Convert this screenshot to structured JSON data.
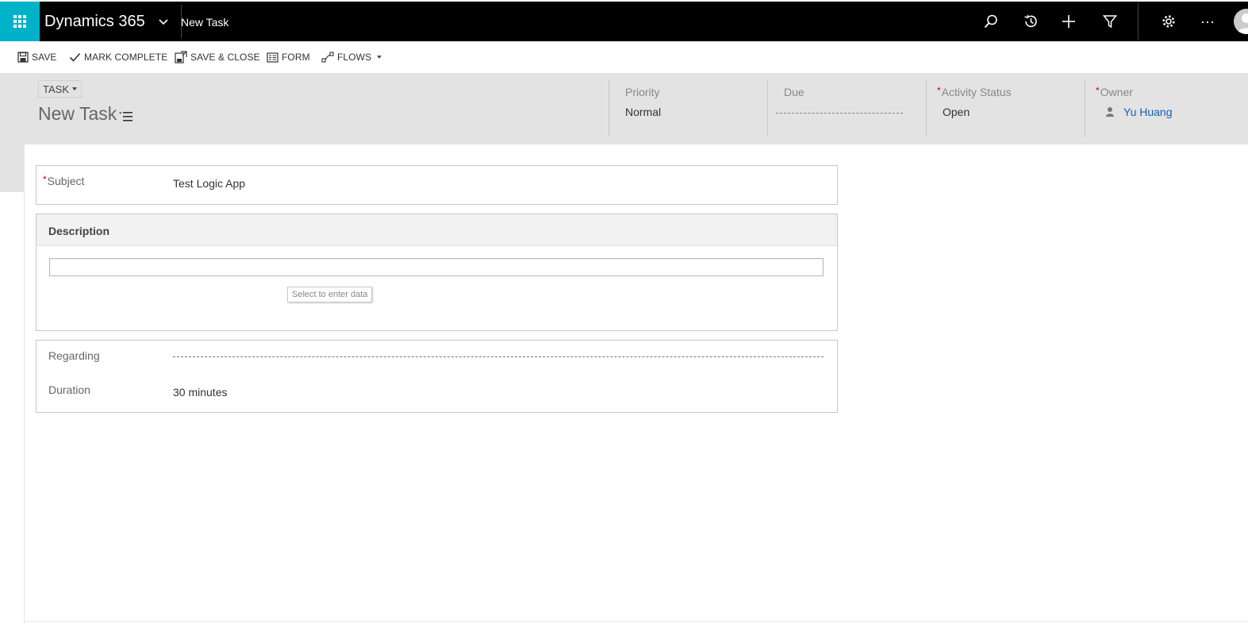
{
  "nav": {
    "app_title": "Dynamics 365",
    "page_crumb": "New Task",
    "icons": [
      "waffle-icon",
      "chevron-down-icon",
      "search-icon",
      "history-icon",
      "plus-icon",
      "filter-icon",
      "gear-icon",
      "more-icon",
      "avatar"
    ]
  },
  "toolbar": {
    "save_label": "SAVE",
    "mark_complete_label": "MARK COMPLETE",
    "save_close_label": "SAVE & CLOSE",
    "form_label": "FORM",
    "flows_label": "FLOWS"
  },
  "header": {
    "entity_label": "TASK",
    "record_title": "New Task",
    "fields": {
      "priority": {
        "label": "Priority",
        "value": "Normal"
      },
      "due": {
        "label": "Due",
        "value": ""
      },
      "activity_status": {
        "label": "Activity Status",
        "value": "Open",
        "required": true
      },
      "owner": {
        "label": "Owner",
        "value": "Yu Huang",
        "required": true
      }
    }
  },
  "form": {
    "subject": {
      "label": "Subject",
      "value": "Test Logic App",
      "required": true
    },
    "description": {
      "title": "Description",
      "value": "",
      "tooltip": "Select to enter data"
    },
    "regarding": {
      "label": "Regarding",
      "value": ""
    },
    "duration": {
      "label": "Duration",
      "value": "30 minutes"
    }
  },
  "colors": {
    "accent": "#00b2c8",
    "nav_bg": "#000000",
    "header_bg": "#e3e3e3",
    "link": "#1160b7",
    "required": "#cc0000"
  }
}
